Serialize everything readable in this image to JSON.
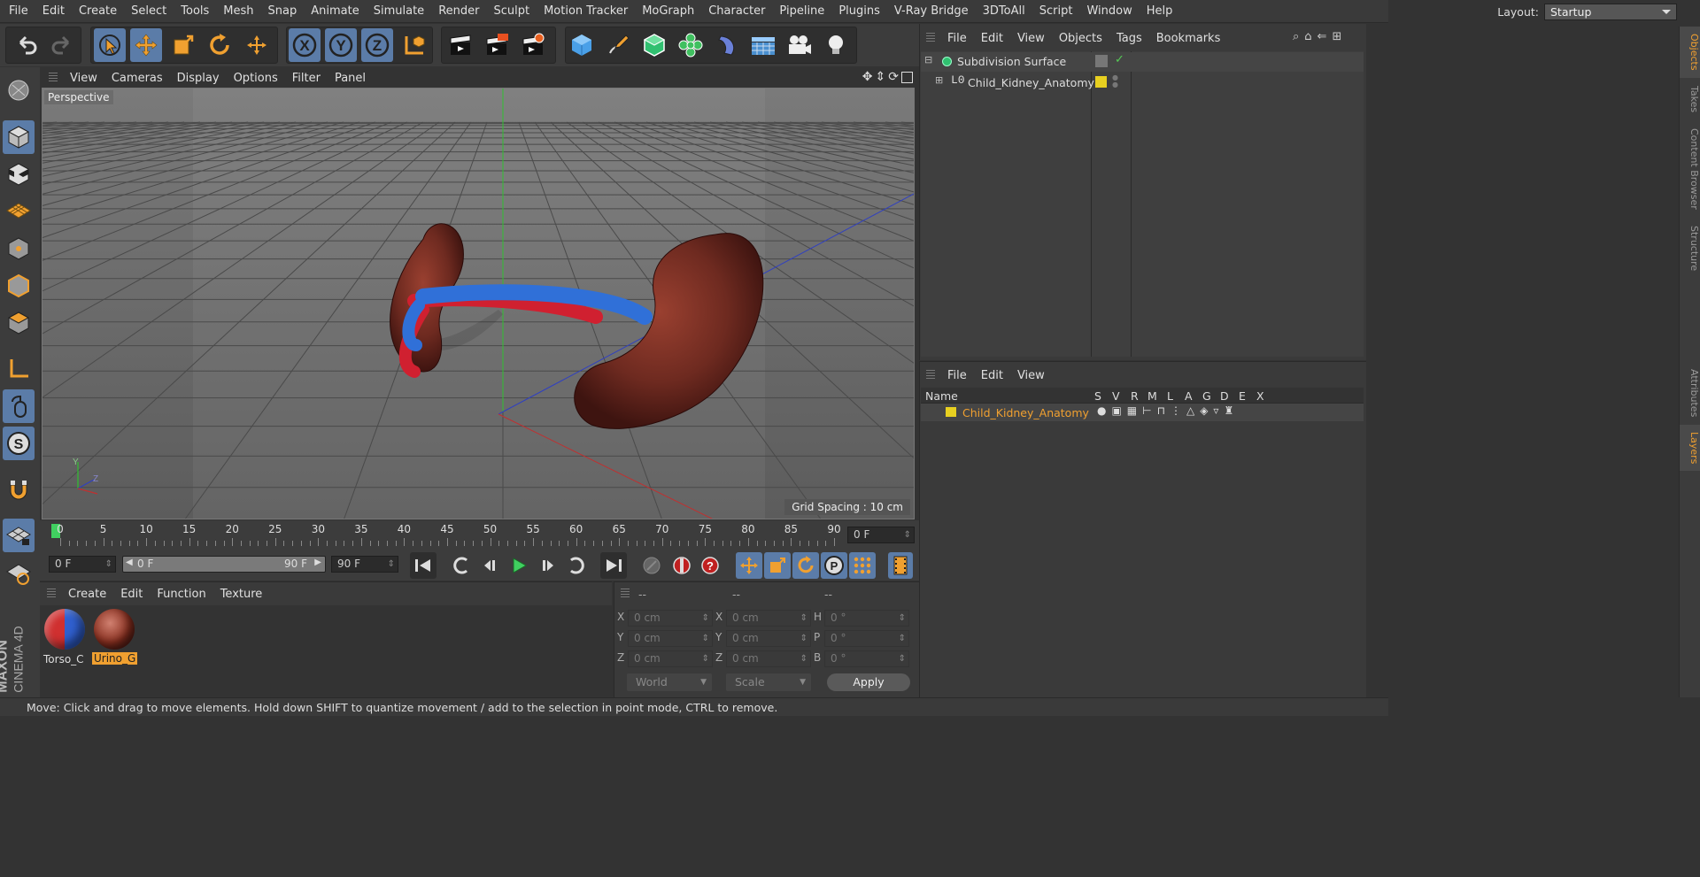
{
  "menubar": {
    "items": [
      "File",
      "Edit",
      "Create",
      "Select",
      "Tools",
      "Mesh",
      "Snap",
      "Animate",
      "Simulate",
      "Render",
      "Sculpt",
      "Motion Tracker",
      "MoGraph",
      "Character",
      "Pipeline",
      "Plugins",
      "V-Ray Bridge",
      "3DToAll",
      "Script",
      "Window",
      "Help"
    ],
    "layout_label": "Layout:",
    "layout_value": "Startup"
  },
  "toolbar": {
    "axis_x": "X",
    "axis_y": "Y",
    "axis_z": "Z"
  },
  "viewport": {
    "menu": [
      "View",
      "Cameras",
      "Display",
      "Options",
      "Filter",
      "Panel"
    ],
    "name": "Perspective",
    "grid_spacing": "Grid Spacing : 10 cm",
    "axis_y": "Y",
    "axis_z": "Z"
  },
  "objects_panel": {
    "menu": [
      "File",
      "Edit",
      "View",
      "Objects",
      "Tags",
      "Bookmarks"
    ],
    "items": [
      {
        "name": "Subdivision Surface"
      },
      {
        "name": "Child_Kidney_Anatomy"
      }
    ]
  },
  "side_tabs": {
    "top": [
      "Objects",
      "Takes",
      "Content Browser",
      "Structure"
    ],
    "bottom": [
      "Attributes",
      "Layers"
    ]
  },
  "layers_panel": {
    "menu": [
      "File",
      "Edit",
      "View"
    ],
    "columns": [
      "Name",
      "S",
      "V",
      "R",
      "M",
      "L",
      "A",
      "G",
      "D",
      "E",
      "X"
    ],
    "rows": [
      {
        "name": "Child_Kidney_Anatomy",
        "color": "#e8d020"
      }
    ]
  },
  "timeline": {
    "ticks": [
      "0",
      "5",
      "10",
      "15",
      "20",
      "25",
      "30",
      "35",
      "40",
      "45",
      "50",
      "55",
      "60",
      "65",
      "70",
      "75",
      "80",
      "85",
      "90"
    ],
    "current_frame": "0 F",
    "start_frame": "0 F",
    "range_start": "0 F",
    "range_end": "90 F",
    "end_frame": "90 F"
  },
  "material_manager": {
    "menu": [
      "Create",
      "Edit",
      "Function",
      "Texture"
    ],
    "materials": [
      {
        "name": "Torso_C"
      },
      {
        "name": "Urino_G"
      }
    ]
  },
  "coordinates": {
    "headers": [
      "--",
      "--",
      "--"
    ],
    "rows": [
      {
        "l1": "X",
        "v1": "0 cm",
        "l2": "X",
        "v2": "0 cm",
        "l3": "H",
        "v3": "0 °"
      },
      {
        "l1": "Y",
        "v1": "0 cm",
        "l2": "Y",
        "v2": "0 cm",
        "l3": "P",
        "v3": "0 °"
      },
      {
        "l1": "Z",
        "v1": "0 cm",
        "l2": "Z",
        "v2": "0 cm",
        "l3": "B",
        "v3": "0 °"
      }
    ],
    "mode": "World",
    "scale": "Scale",
    "apply": "Apply"
  },
  "branding": {
    "maxon": "MAXON",
    "product": "CINEMA 4D"
  },
  "status": "Move: Click and drag to move elements. Hold down SHIFT to quantize movement / add to the selection in point mode, CTRL to remove."
}
